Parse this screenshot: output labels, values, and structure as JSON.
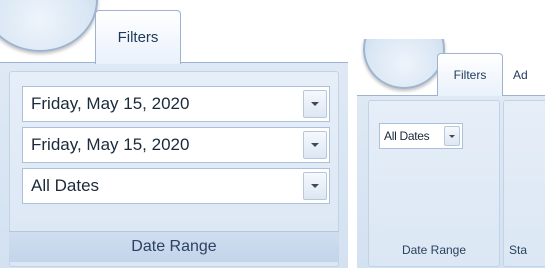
{
  "large_ribbon": {
    "tab_label": "Filters",
    "group_caption": "Date Range",
    "fields": [
      {
        "value": "Friday, May 15, 2020"
      },
      {
        "value": "Friday, May 15, 2020"
      },
      {
        "value": "All Dates"
      }
    ]
  },
  "small_ribbon": {
    "tabs": [
      "Filters",
      "Ad"
    ],
    "field_value": "All Dates",
    "group_captions": [
      "Date Range",
      "Sta"
    ]
  },
  "icons": {
    "dropdown": "chevron-down-icon",
    "orb": "application-menu-orb"
  },
  "colors": {
    "ribbon_blue": "#dfe9f5",
    "tab_text": "#1e395b",
    "border": "#9db3cf"
  }
}
